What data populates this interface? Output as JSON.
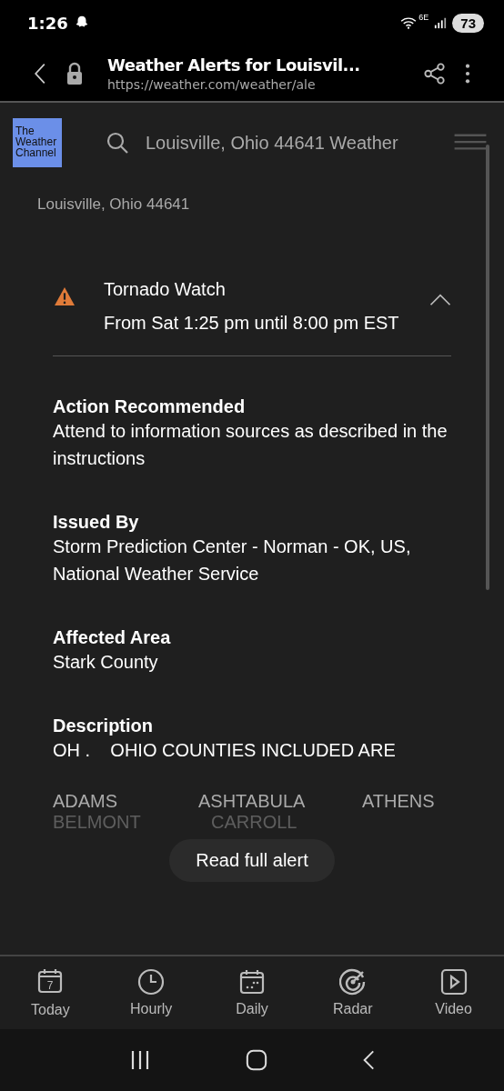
{
  "status_bar": {
    "time": "1:26",
    "network": "6E",
    "battery": "73"
  },
  "browser": {
    "title": "Weather Alerts for Louisvil...",
    "url": "https://weather.com/weather/ale"
  },
  "header": {
    "logo": "The Weather Channel",
    "search": {
      "value": "Louisville, Ohio 44641 Weather"
    }
  },
  "location": "Louisville, Ohio 44641",
  "alert": {
    "title": "Tornado Watch",
    "time": "From Sat 1:25 pm until 8:00 pm EST",
    "expanded": true
  },
  "sections": [
    {
      "heading": "Action Recommended",
      "text": "Attend to information sources as described in the instructions"
    },
    {
      "heading": "Issued By",
      "text": "Storm Prediction Center - Norman - OK, US, National Weather Service"
    },
    {
      "heading": "Affected Area",
      "text": "Stark County"
    },
    {
      "heading": "Description",
      "text": "OH .    OHIO COUNTIES INCLUDED ARE"
    }
  ],
  "counties": [
    [
      "ADAMS",
      "ASHTABULA",
      "ATHENS"
    ],
    [
      "BELMONT",
      "CARROLL"
    ]
  ],
  "read_more": "Read full alert",
  "bottom_nav": [
    {
      "label": "Today",
      "icon_text": "7"
    },
    {
      "label": "Hourly"
    },
    {
      "label": "Daily"
    },
    {
      "label": "Radar"
    },
    {
      "label": "Video"
    }
  ]
}
